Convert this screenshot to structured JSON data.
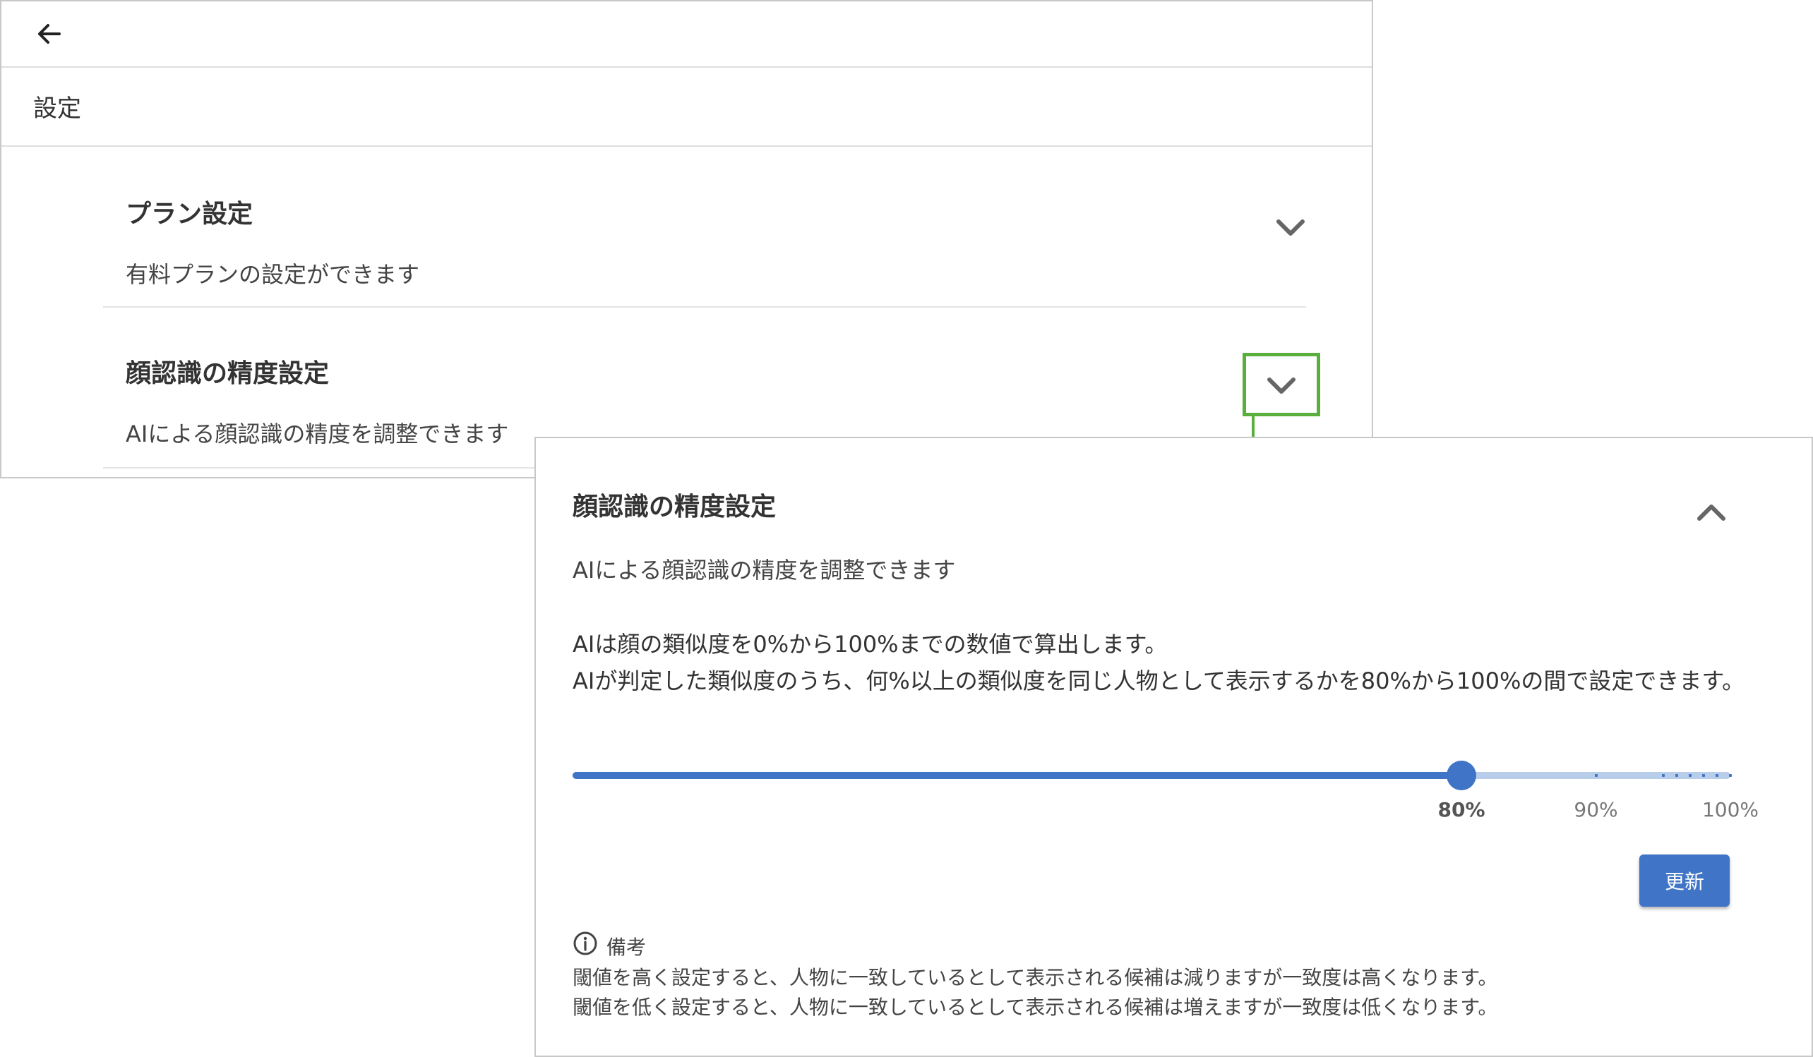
{
  "header": {
    "back_icon": "arrow-left-icon",
    "page_title": "設定"
  },
  "sections": [
    {
      "title": "プラン設定",
      "description": "有料プランの設定ができます",
      "toggle_icon": "chevron-down-icon"
    },
    {
      "title": "顔認識の精度設定",
      "description": "AIによる顔認識の精度を調整できます",
      "toggle_icon": "chevron-down-icon"
    }
  ],
  "annotation": {
    "color": "#5aaf3c"
  },
  "expanded_panel": {
    "title": "顔認識の精度設定",
    "description": "AIによる顔認識の精度を調整できます",
    "toggle_icon": "chevron-up-icon",
    "explanation": [
      "AIは顔の類似度を0%から100%までの数値で算出します。",
      "AIが判定した類似度のうち、何%以上の類似度を同じ人物として表示するかを80%から100%の間で設定できます。"
    ],
    "slider": {
      "value_percent": 80,
      "rail_min_percent": 0,
      "rail_max_percent": 100,
      "marks": [
        {
          "value": 80,
          "label": "80%"
        },
        {
          "value": 90,
          "label": "90%"
        },
        {
          "value": 100,
          "label": "100%"
        }
      ],
      "ticks": [
        90,
        95,
        96,
        97,
        98,
        99,
        100
      ],
      "accent_color": "#3f74c6"
    },
    "update_button_label": "更新",
    "notes": {
      "icon": "info-circle-icon",
      "label": "備考",
      "lines": [
        "閾値を高く設定すると、人物に一致しているとして表示される候補は減りますが一致度は高くなります。",
        "閾値を低く設定すると、人物に一致しているとして表示される候補は増えますが一致度は低くなります。"
      ]
    }
  }
}
